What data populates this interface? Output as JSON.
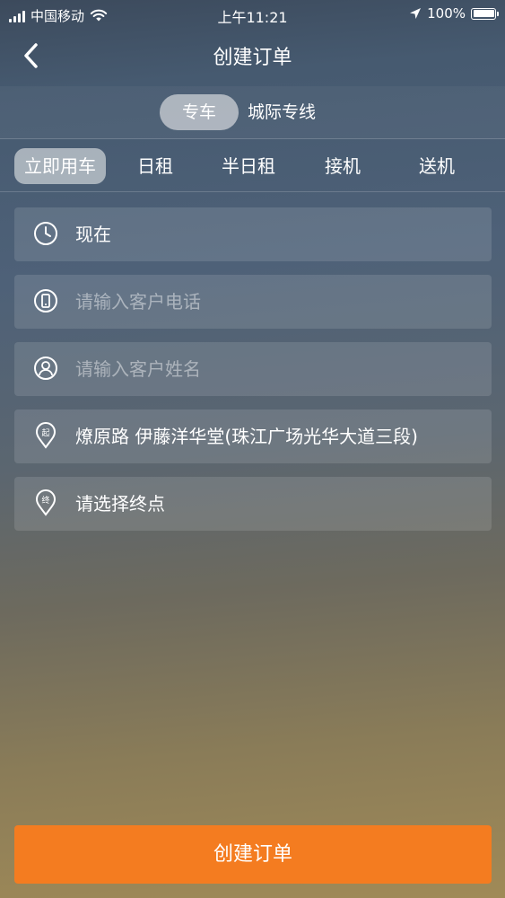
{
  "status_bar": {
    "carrier": "中国移动",
    "time": "上午11:21",
    "battery": "100%",
    "battery_level": 1.0
  },
  "nav": {
    "title": "创建订单",
    "back_icon": "chevron-left-icon"
  },
  "service_segment": {
    "items": [
      {
        "label": "专车",
        "active": true
      },
      {
        "label": "城际专线",
        "active": false
      }
    ]
  },
  "type_tabs": {
    "items": [
      {
        "label": "立即用车",
        "active": true
      },
      {
        "label": "日租",
        "active": false
      },
      {
        "label": "半日租",
        "active": false
      },
      {
        "label": "接机",
        "active": false
      },
      {
        "label": "送机",
        "active": false
      }
    ]
  },
  "form": {
    "time": {
      "value": "现在",
      "icon": "clock-icon"
    },
    "phone": {
      "placeholder": "请输入客户电话",
      "icon": "phone-icon"
    },
    "name": {
      "placeholder": "请输入客户姓名",
      "icon": "user-icon"
    },
    "origin": {
      "value": "燎原路 伊藤洋华堂(珠江广场光华大道三段)",
      "icon": "start-location-icon",
      "icon_text": "起"
    },
    "destination": {
      "value": "请选择终点",
      "icon": "end-location-icon",
      "icon_text": "终"
    }
  },
  "submit": {
    "label": "创建订单",
    "color": "#f47c20"
  }
}
